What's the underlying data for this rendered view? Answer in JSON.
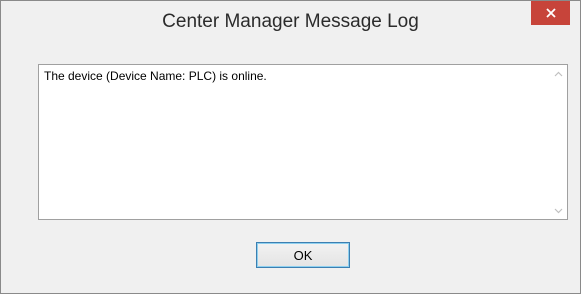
{
  "window": {
    "title": "Center Manager Message Log",
    "close_icon": "close-icon"
  },
  "log": {
    "message": "The device (Device Name: PLC) is online."
  },
  "buttons": {
    "ok_label": "OK"
  },
  "colors": {
    "close_button": "#c7443a",
    "window_background": "#f0f0f0",
    "button_border": "#3c7fb1"
  }
}
